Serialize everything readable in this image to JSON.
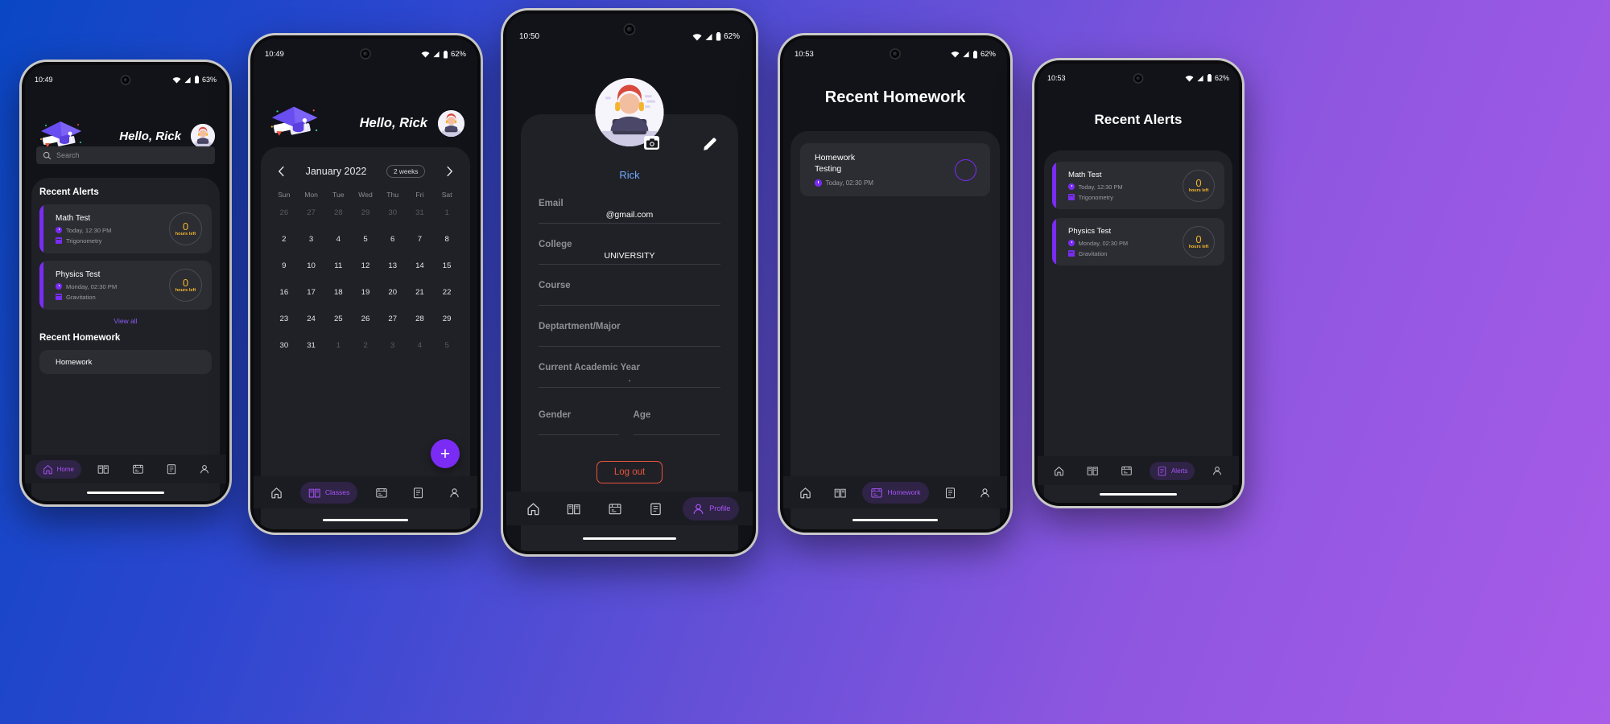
{
  "theme": {
    "accent_purple": "#7a2cf5",
    "accent_light_purple": "#a855f7",
    "amber": "#f2b52c",
    "link_blue": "#6ea8fe",
    "logout_red": "#e8543f",
    "screen_bg": "#121319",
    "panel_bg": "#202126",
    "card_bg": "#2c2d33",
    "nav_bg": "#1b1c21",
    "bg_gradient_from": "#0a47c4",
    "bg_gradient_to": "#a85ce8"
  },
  "nav": {
    "items": [
      {
        "icon": "home-icon",
        "label": "Home"
      },
      {
        "icon": "classes-icon",
        "label": "Classes"
      },
      {
        "icon": "homework-icon",
        "label": "Homework"
      },
      {
        "icon": "alerts-icon",
        "label": "Alerts"
      },
      {
        "icon": "profile-icon",
        "label": "Profile"
      }
    ]
  },
  "phone1": {
    "status": {
      "time": "10:49",
      "battery": "63%",
      "wifi": "wifi-icon",
      "signal": "signal-icon",
      "batt_icon": "battery-icon"
    },
    "header": {
      "logo": "graduation-cap-icon",
      "greeting": "Hello, Rick",
      "avatar": "user-avatar"
    },
    "search": {
      "placeholder": "Search",
      "icon": "search-icon",
      "value": ""
    },
    "sections": {
      "alerts_title": "Recent Alerts",
      "view_all": "View all",
      "homework_title": "Recent Homework"
    },
    "alerts": [
      {
        "title": "Math Test",
        "time": "Today, 12:30 PM",
        "subject": "Trigonometry",
        "count": "0",
        "unit": "hours left"
      },
      {
        "title": "Physics Test",
        "time": "Monday, 02:30 PM",
        "subject": "Gravitation",
        "count": "0",
        "unit": "hours left"
      }
    ],
    "homework_preview": {
      "title": "Homework"
    },
    "active_nav": "Home"
  },
  "phone2": {
    "status": {
      "time": "10:49",
      "battery": "62%"
    },
    "header": {
      "logo": "graduation-cap-icon",
      "greeting": "Hello, Rick",
      "avatar": "user-avatar"
    },
    "calendar": {
      "prev": "chevron-left-icon",
      "next": "chevron-right-icon",
      "month": "January 2022",
      "range_chip": "2 weeks",
      "weekdays": [
        "Sun",
        "Mon",
        "Tue",
        "Wed",
        "Thu",
        "Fri",
        "Sat"
      ],
      "weeks": [
        [
          {
            "d": "26",
            "muted": true
          },
          {
            "d": "27",
            "muted": true
          },
          {
            "d": "28",
            "muted": true
          },
          {
            "d": "29",
            "muted": true
          },
          {
            "d": "30",
            "muted": true
          },
          {
            "d": "31",
            "muted": true
          },
          {
            "d": "1",
            "muted": true
          }
        ],
        [
          {
            "d": "2"
          },
          {
            "d": "3"
          },
          {
            "d": "4"
          },
          {
            "d": "5"
          },
          {
            "d": "6"
          },
          {
            "d": "7"
          },
          {
            "d": "8"
          }
        ],
        [
          {
            "d": "9"
          },
          {
            "d": "10"
          },
          {
            "d": "11"
          },
          {
            "d": "12"
          },
          {
            "d": "13"
          },
          {
            "d": "14"
          },
          {
            "d": "15"
          }
        ],
        [
          {
            "d": "16"
          },
          {
            "d": "17"
          },
          {
            "d": "18"
          },
          {
            "d": "19"
          },
          {
            "d": "20"
          },
          {
            "d": "21"
          },
          {
            "d": "22"
          }
        ],
        [
          {
            "d": "23"
          },
          {
            "d": "24"
          },
          {
            "d": "25"
          },
          {
            "d": "26"
          },
          {
            "d": "27"
          },
          {
            "d": "28"
          },
          {
            "d": "29"
          }
        ],
        [
          {
            "d": "30"
          },
          {
            "d": "31"
          },
          {
            "d": "1",
            "muted": true
          },
          {
            "d": "2",
            "muted": true
          },
          {
            "d": "3",
            "muted": true
          },
          {
            "d": "4",
            "muted": true
          },
          {
            "d": "5",
            "muted": true
          }
        ]
      ]
    },
    "fab": {
      "icon": "plus-icon",
      "label": "+"
    },
    "active_nav": "Classes"
  },
  "phone3": {
    "status": {
      "time": "10:50",
      "battery": "62%"
    },
    "avatar": "user-avatar",
    "camera_badge": "camera-icon",
    "edit": "pencil-icon",
    "name": "Rick",
    "fields": [
      {
        "label": "Email",
        "value": "@gmail.com"
      },
      {
        "label": "College",
        "value": "UNIVERSITY"
      },
      {
        "label": "Course",
        "value": ""
      },
      {
        "label": "Deptartment/Major",
        "value": ""
      },
      {
        "label": "Current Academic Year",
        "value": "."
      }
    ],
    "gender_label": "Gender",
    "gender_value": "",
    "age_label": "Age",
    "age_value": "",
    "logout": "Log out",
    "active_nav": "Profile"
  },
  "phone4": {
    "status": {
      "time": "10:53",
      "battery": "62%"
    },
    "title": "Recent Homework",
    "items": [
      {
        "title_line1": "Homework",
        "title_line2": "Testing",
        "time": "Today, 02:30 PM",
        "ring": ""
      }
    ],
    "active_nav": "Homework"
  },
  "phone5": {
    "status": {
      "time": "10:53",
      "battery": "62%"
    },
    "title": "Recent Alerts",
    "alerts": [
      {
        "title": "Math Test",
        "time": "Today, 12:30 PM",
        "subject": "Trigonometry",
        "count": "0",
        "unit": "hours left"
      },
      {
        "title": "Physics Test",
        "time": "Monday, 02:30 PM",
        "subject": "Gravitation",
        "count": "0",
        "unit": "hours left"
      }
    ],
    "active_nav": "Alerts"
  }
}
